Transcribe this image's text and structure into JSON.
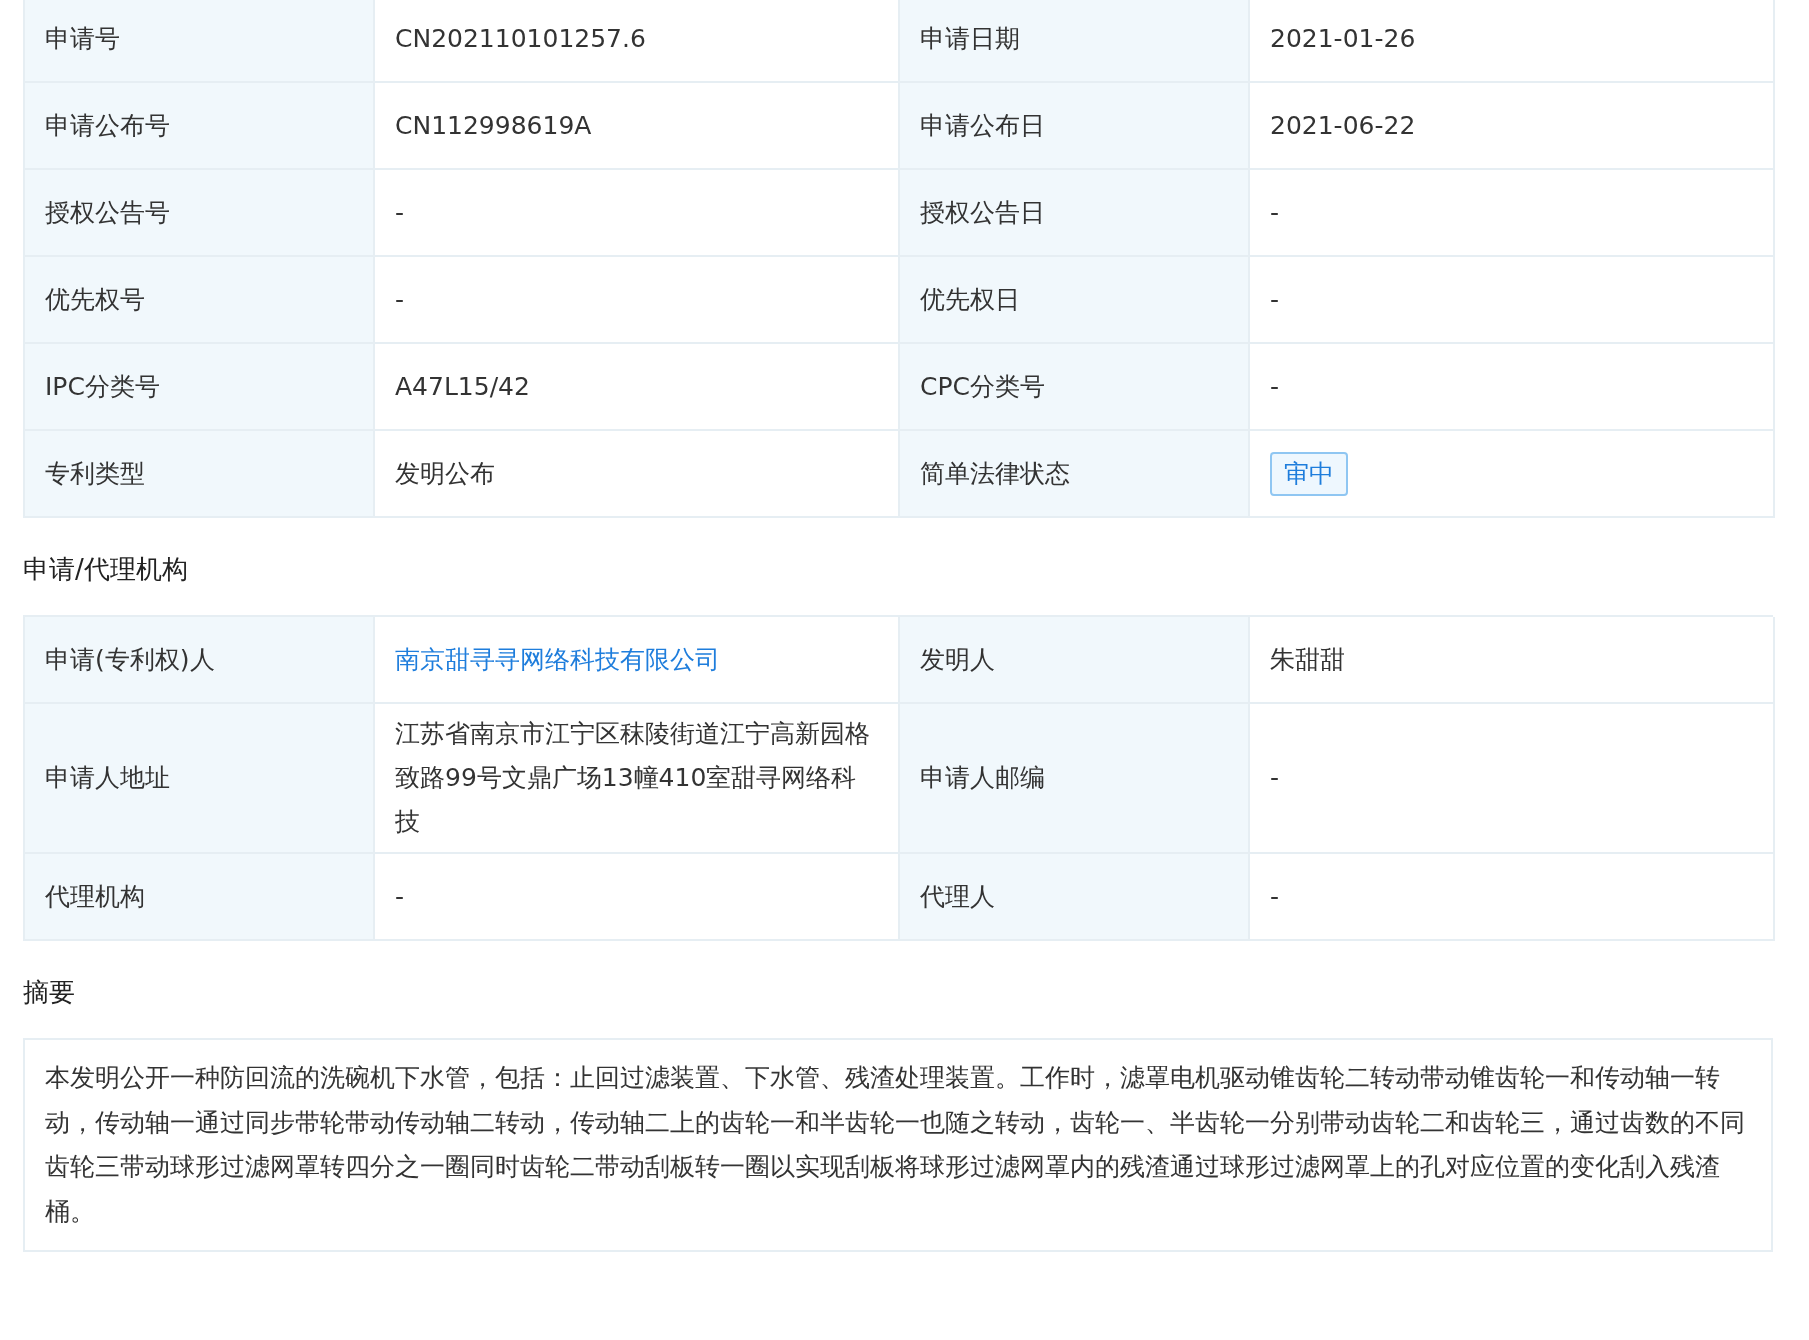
{
  "basic_table": {
    "rows": [
      {
        "cells": [
          {
            "label": "申请号",
            "value": "CN202110101257.6",
            "kind": "text"
          },
          {
            "label": "申请日期",
            "value": "2021-01-26",
            "kind": "text"
          }
        ]
      },
      {
        "cells": [
          {
            "label": "申请公布号",
            "value": "CN112998619A",
            "kind": "text"
          },
          {
            "label": "申请公布日",
            "value": "2021-06-22",
            "kind": "text"
          }
        ]
      },
      {
        "cells": [
          {
            "label": "授权公告号",
            "value": "-",
            "kind": "text"
          },
          {
            "label": "授权公告日",
            "value": "-",
            "kind": "text"
          }
        ]
      },
      {
        "cells": [
          {
            "label": "优先权号",
            "value": "-",
            "kind": "text"
          },
          {
            "label": "优先权日",
            "value": "-",
            "kind": "text"
          }
        ]
      },
      {
        "cells": [
          {
            "label": "IPC分类号",
            "value": "A47L15/42",
            "kind": "text"
          },
          {
            "label": "CPC分类号",
            "value": "-",
            "kind": "text"
          }
        ]
      },
      {
        "cells": [
          {
            "label": "专利类型",
            "value": "发明公布",
            "kind": "text"
          },
          {
            "label": "简单法律状态",
            "value": "审中",
            "kind": "tag"
          }
        ]
      }
    ]
  },
  "agency_section": {
    "title": "申请/代理机构",
    "rows": [
      {
        "cells": [
          {
            "label": "申请(专利权)人",
            "value": "南京甜寻寻网络科技有限公司",
            "kind": "link"
          },
          {
            "label": "发明人",
            "value": "朱甜甜",
            "kind": "text"
          }
        ]
      },
      {
        "cells": [
          {
            "label": "申请人地址",
            "value": "江苏省南京市江宁区秣陵街道江宁高新园格致路99号文鼎广场13幢410室甜寻网络科技",
            "kind": "text"
          },
          {
            "label": "申请人邮编",
            "value": "-",
            "kind": "text"
          }
        ]
      },
      {
        "cells": [
          {
            "label": "代理机构",
            "value": "-",
            "kind": "text"
          },
          {
            "label": "代理人",
            "value": "-",
            "kind": "text"
          }
        ]
      }
    ]
  },
  "abstract_section": {
    "title": "摘要",
    "text": "本发明公开一种防回流的洗碗机下水管，包括：止回过滤装置、下水管、残渣处理装置。工作时，滤罩电机驱动锥齿轮二转动带动锥齿轮一和传动轴一转动，传动轴一通过同步带轮带动传动轴二转动，传动轴二上的齿轮一和半齿轮一也随之转动，齿轮一、半齿轮一分别带动齿轮二和齿轮三，通过齿数的不同齿轮三带动球形过滤网罩转四分之一圈同时齿轮二带动刮板转一圈以实现刮板将球形过滤网罩内的残渣通过球形过滤网罩上的孔对应位置的变化刮入残渣桶。"
  }
}
